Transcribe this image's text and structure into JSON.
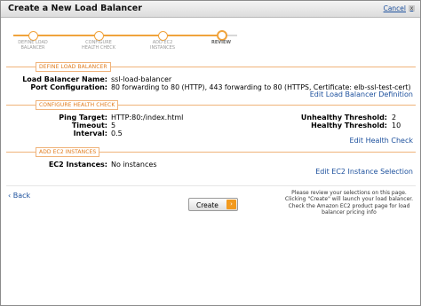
{
  "dialog": {
    "title": "Create a New Load Balancer",
    "cancel_label": "Cancel",
    "cancel_x": "x"
  },
  "wizard": {
    "steps": [
      {
        "line1": "DEFINE LOAD",
        "line2": "BALANCER"
      },
      {
        "line1": "CONFIGURE",
        "line2": "HEALTH CHECK"
      },
      {
        "line1": "ADD EC2",
        "line2": "INSTANCES"
      },
      {
        "line1": "REVIEW",
        "line2": ""
      }
    ],
    "current_step": 4
  },
  "sections": {
    "define": {
      "tag": "DEFINE LOAD BALANCER",
      "name_label": "Load Balancer Name:",
      "name_value": "ssl-load-balancer",
      "port_label": "Port Configuration:",
      "port_value": "80 forwarding to 80 (HTTP), 443 forwarding to 80 (HTTPS, Certificate: elb-ssl-test-cert)",
      "edit_link": "Edit Load Balancer Definition"
    },
    "health": {
      "tag": "CONFIGURE HEALTH CHECK",
      "ping_label": "Ping Target:",
      "ping_value": "HTTP:80:/index.html",
      "timeout_label": "Timeout:",
      "timeout_value": "5",
      "interval_label": "Interval:",
      "interval_value": "0.5",
      "unhealthy_label": "Unhealthy Threshold:",
      "unhealthy_value": "2",
      "healthy_label": "Healthy Threshold:",
      "healthy_value": "10",
      "edit_link": "Edit Health Check"
    },
    "ec2": {
      "tag": "ADD EC2 INSTANCES",
      "instances_label": "EC2 Instances:",
      "instances_value": "No instances",
      "edit_link": "Edit EC2 Instance Selection"
    }
  },
  "footer": {
    "back_label": "Back",
    "back_arrow": "‹",
    "create_label": "Create",
    "create_arrow": "›",
    "note_lines": [
      "Please review your selections on this page.",
      "Clicking \"Create\" will launch your load balancer.",
      "Check the Amazon EC2 product page for load",
      "balancer pricing info"
    ]
  },
  "colors": {
    "accent": "#f0a33c",
    "link": "#1b4f9c",
    "section_tag": "#e07a1a"
  }
}
